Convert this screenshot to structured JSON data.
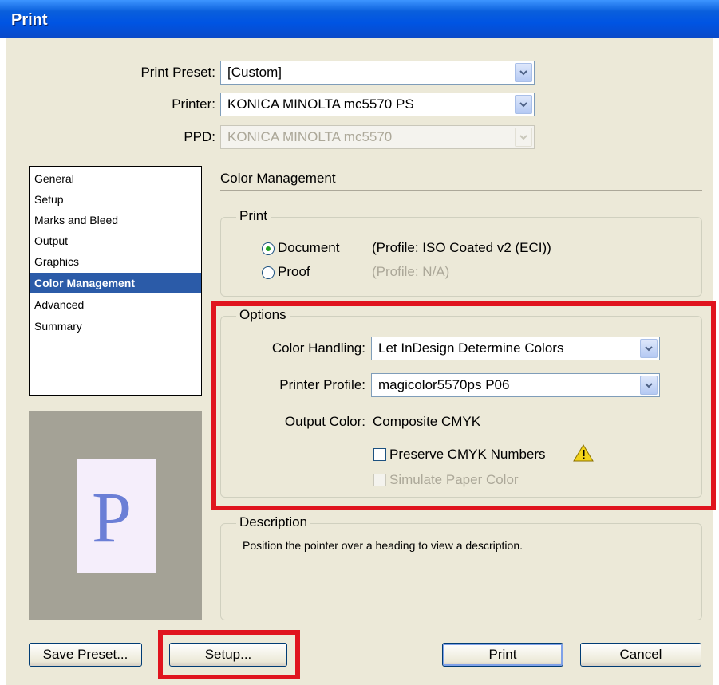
{
  "window": {
    "title": "Print"
  },
  "top": {
    "preset_label": "Print Preset:",
    "preset_value": "[Custom]",
    "printer_label": "Printer:",
    "printer_value": "KONICA MINOLTA mc5570 PS",
    "ppd_label": "PPD:",
    "ppd_value": "KONICA MINOLTA mc5570"
  },
  "sidebar": {
    "items": [
      {
        "label": "General"
      },
      {
        "label": "Setup"
      },
      {
        "label": "Marks and Bleed"
      },
      {
        "label": "Output"
      },
      {
        "label": "Graphics"
      },
      {
        "label": "Color Management"
      },
      {
        "label": "Advanced"
      },
      {
        "label": "Summary"
      }
    ],
    "selected": "Color Management"
  },
  "preview": {
    "letter": "P"
  },
  "main": {
    "heading": "Color Management",
    "print_group": {
      "title": "Print",
      "document_label": "Document",
      "document_profile": "(Profile: ISO Coated v2 (ECI))",
      "proof_label": "Proof",
      "proof_profile": "(Profile: N/A)"
    },
    "options_group": {
      "title": "Options",
      "color_handling_label": "Color Handling:",
      "color_handling_value": "Let InDesign Determine Colors",
      "printer_profile_label": "Printer Profile:",
      "printer_profile_value": "magicolor5570ps P06",
      "output_color_label": "Output Color:",
      "output_color_value": "Composite CMYK",
      "preserve_label": "Preserve CMYK Numbers",
      "simulate_label": "Simulate Paper Color"
    },
    "description_group": {
      "title": "Description",
      "text": "Position the pointer over a heading to view a description."
    }
  },
  "buttons": {
    "save_preset": "Save Preset...",
    "setup": "Setup...",
    "print": "Print",
    "cancel": "Cancel"
  },
  "colors": {
    "highlight": "#e0141e",
    "selection": "#2b5ba8",
    "titlebar": "#0054e3"
  }
}
